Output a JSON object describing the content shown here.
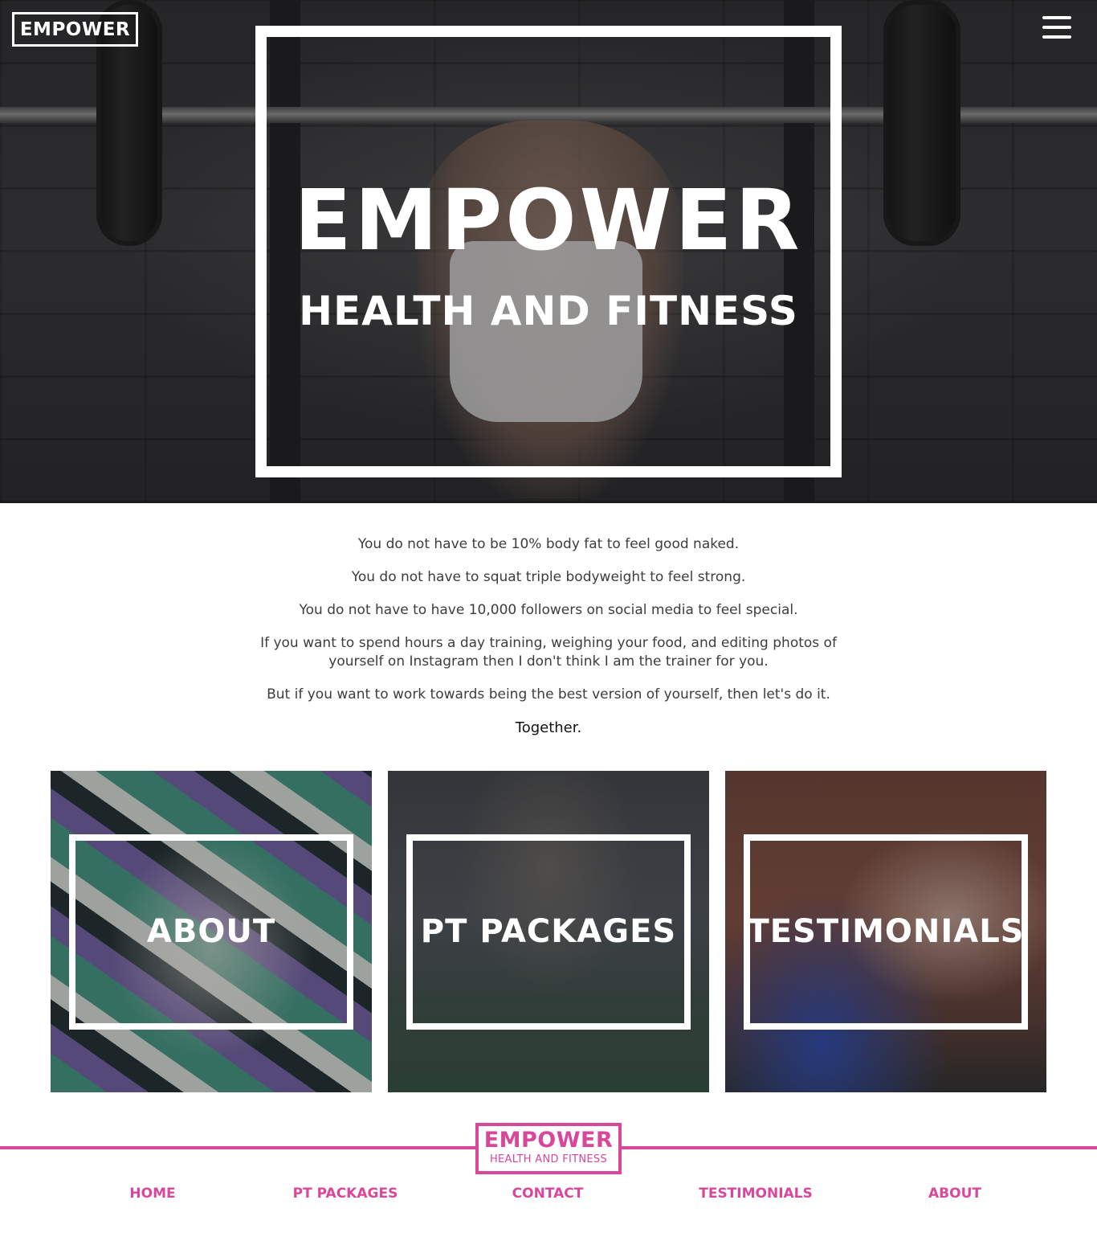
{
  "header": {
    "logo_text": "EMPOWER",
    "menu_icon": "hamburger-menu-icon"
  },
  "hero": {
    "title": "EMPOWER",
    "subtitle": "HEALTH AND FITNESS"
  },
  "intro": {
    "paragraphs": [
      "You do not have to be 10% body fat to feel good naked.",
      "You do not have to squat triple bodyweight to feel strong.",
      "You do not have to have 10,000 followers on social media to feel special.",
      "If you want to spend hours a day training, weighing your food, and editing photos of yourself on Instagram then I don't think I am the trainer for you.",
      "But if you want to work towards being the best version of yourself, then let's do it."
    ],
    "closing": "Together."
  },
  "cards": [
    {
      "label": "ABOUT"
    },
    {
      "label": "PT PACKAGES"
    },
    {
      "label": "TESTIMONIALS"
    }
  ],
  "footer": {
    "logo_title": "EMPOWER",
    "logo_subtitle": "HEALTH AND FITNESS",
    "nav": [
      "HOME",
      "PT PACKAGES",
      "CONTACT",
      "TESTIMONIALS",
      "ABOUT"
    ]
  },
  "colors": {
    "accent": "#d9479a",
    "hero_text": "#ffffff",
    "body_text": "#3d3d3d"
  }
}
